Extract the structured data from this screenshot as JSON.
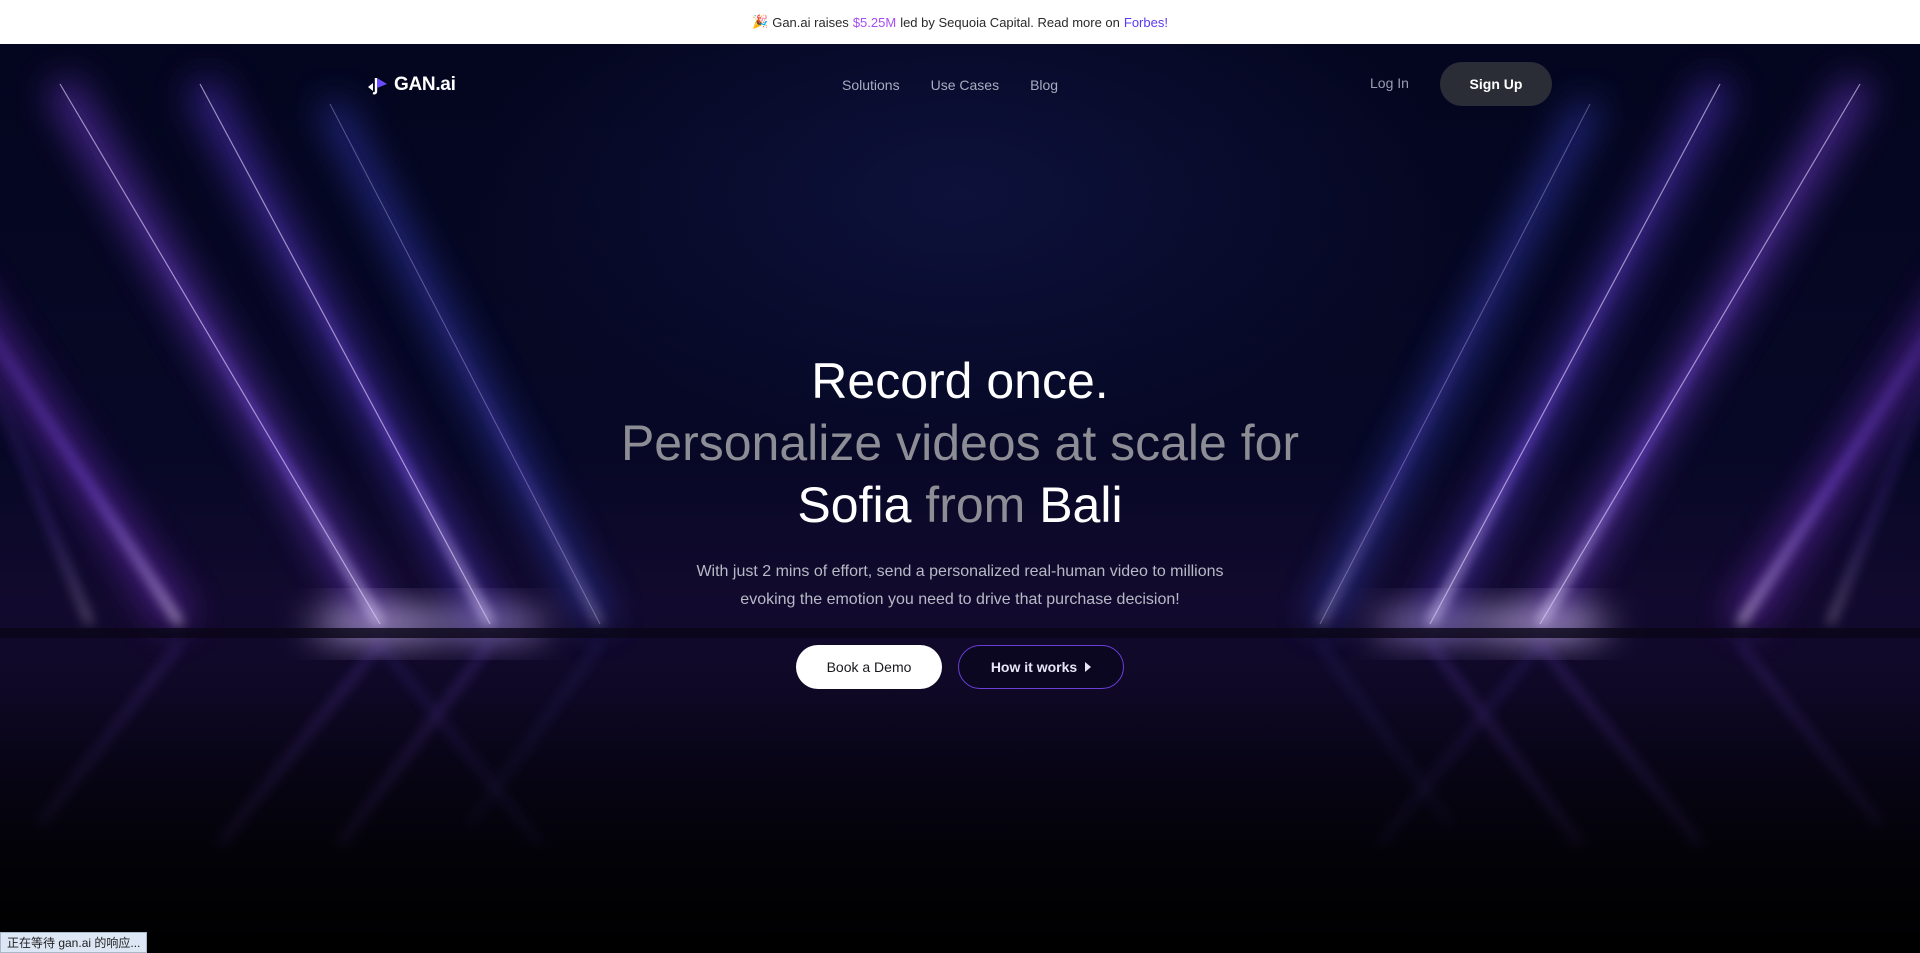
{
  "announcement": {
    "icon": "party-popper-icon",
    "prefix": "Gan.ai raises",
    "amount": "$5.25M",
    "middle": "led by Sequoia Capital. Read more on",
    "link": "Forbes!"
  },
  "nav": {
    "logo_text": "GAN.ai",
    "links": [
      "Solutions",
      "Use Cases",
      "Blog"
    ],
    "login": "Log In",
    "signup": "Sign Up"
  },
  "hero": {
    "headline_line1": "Record once.",
    "headline_line2": "Personalize videos at scale for",
    "headline_name": "Sofia",
    "headline_from": "from",
    "headline_place": "Bali",
    "sub_line1": "With just 2 mins of effort, send a personalized real-human video to millions",
    "sub_line2": "evoking the emotion you need to drive that purchase decision!",
    "cta_primary": "Book a Demo",
    "cta_secondary": "How it works"
  },
  "status_bar": "正在等待 gan.ai 的响应...",
  "colors": {
    "accent_purple": "#a44df2",
    "link_blue": "#5b39f5",
    "background": "#03041a"
  }
}
